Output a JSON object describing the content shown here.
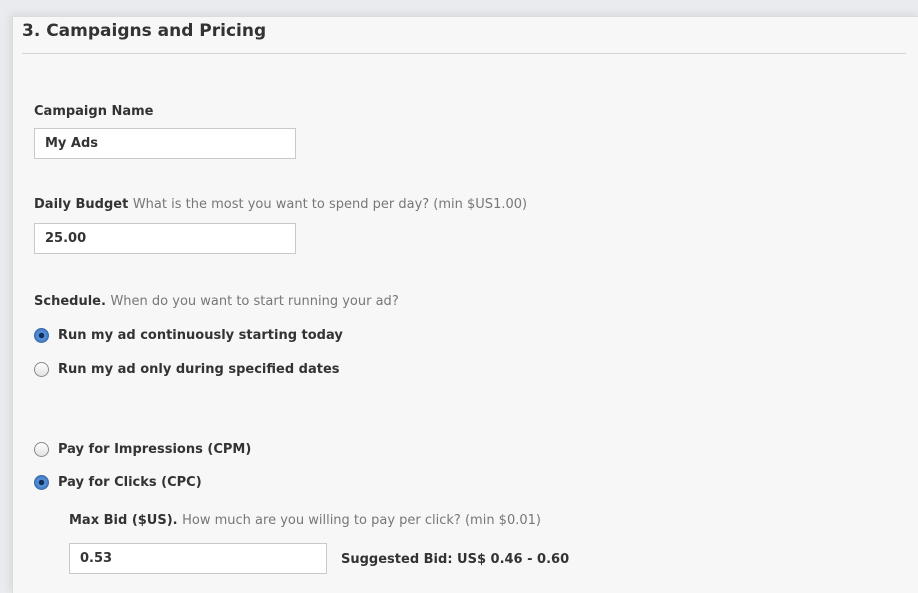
{
  "section": {
    "title": "3. Campaigns and Pricing"
  },
  "campaign_name": {
    "label": "Campaign Name",
    "value": "My Ads"
  },
  "daily_budget": {
    "label": "Daily Budget",
    "hint": "What is the most you want to spend per day? (min $US1.00)",
    "value": "25.00"
  },
  "schedule": {
    "label": "Schedule.",
    "hint": "When do you want to start running your ad?",
    "options": [
      {
        "label": "Run my ad continuously starting today",
        "checked": true
      },
      {
        "label": "Run my ad only during specified dates",
        "checked": false
      }
    ]
  },
  "pricing": {
    "options": [
      {
        "label": "Pay for Impressions (CPM)",
        "checked": false
      },
      {
        "label": "Pay for Clicks (CPC)",
        "checked": true
      }
    ]
  },
  "max_bid": {
    "label": "Max Bid ($US).",
    "hint": "How much are you willing to pay per click? (min $0.01)",
    "value": "0.53",
    "suggested": "Suggested Bid: US$ 0.46 - 0.60"
  }
}
